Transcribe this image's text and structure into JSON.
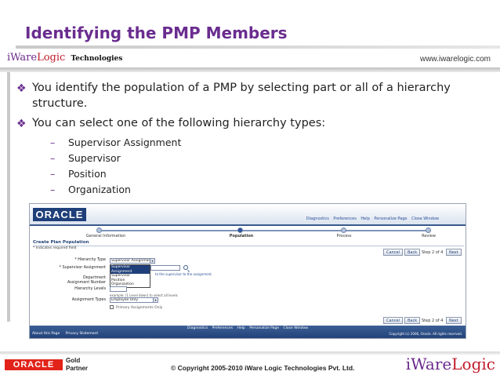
{
  "slide": {
    "title": "Identifying the PMP Members",
    "brand": {
      "iware": "iWare",
      "logic": "Logic",
      "tech": "Technologies"
    },
    "website": "www.iwarelogic.com",
    "bullets": [
      "You identify the population of a PMP by selecting part or all of a hierarchy structure.",
      "You can select one of the following hierarchy types:"
    ],
    "sub_bullets": [
      "Supervisor Assignment",
      "Supervisor",
      "Position",
      "Organization"
    ]
  },
  "oracle_ui": {
    "logo": "ORACLE",
    "global_links": [
      "Diagnostics",
      "Preferences",
      "Help",
      "Personalize Page",
      "Close Window"
    ],
    "train": [
      "General Information",
      "Population",
      "Process",
      "Review"
    ],
    "train_active_index": 1,
    "page_title": "Create Plan Population",
    "required_note": "* Indicates required field",
    "cancel": "Cancel",
    "back": "Back",
    "step": "Step 2 of 4",
    "next": "Next",
    "fields": {
      "hierarchy_type_label": "* Hierarchy Type",
      "hierarchy_type_value": "Supervisor Assignment",
      "supervisor_assignment_label": "* Supervisor Assignment",
      "department_label": "Department",
      "assignment_number_label": "Assignment Number",
      "hierarchy_levels_label": "Hierarchy Levels",
      "assignment_types_label": "Assignment Types",
      "assignment_types_value": "Employee Only",
      "primary_assignments_label": "Primary Assignments Only"
    },
    "dropdown_options": [
      "Supervisor Assignment",
      "Supervisor",
      "Position",
      "Organization"
    ],
    "hints": {
      "supervisor": "to the supervisor to the assignment.",
      "levels": "example: (1 Level down) to select all levels"
    },
    "footer_links": [
      "Diagnostics",
      "Preferences",
      "Help",
      "Personalize Page",
      "Close Window"
    ],
    "footer_left": [
      "About this Page",
      "Privacy Statement"
    ],
    "footer_copyright": "Copyright (c) 2006, Oracle. All rights reserved."
  },
  "footer": {
    "oracle_logo": "ORACLE",
    "gold": "Gold",
    "partner": "Partner",
    "copyright": "© Copyright 2005-2010 iWare Logic Technologies Pvt. Ltd.",
    "logo": {
      "iware": "iWare",
      "logic": "Logic"
    }
  },
  "colors": {
    "title": "#6a2d8f",
    "oracle_blue": "#23437a",
    "oracle_red": "#e2231a"
  }
}
